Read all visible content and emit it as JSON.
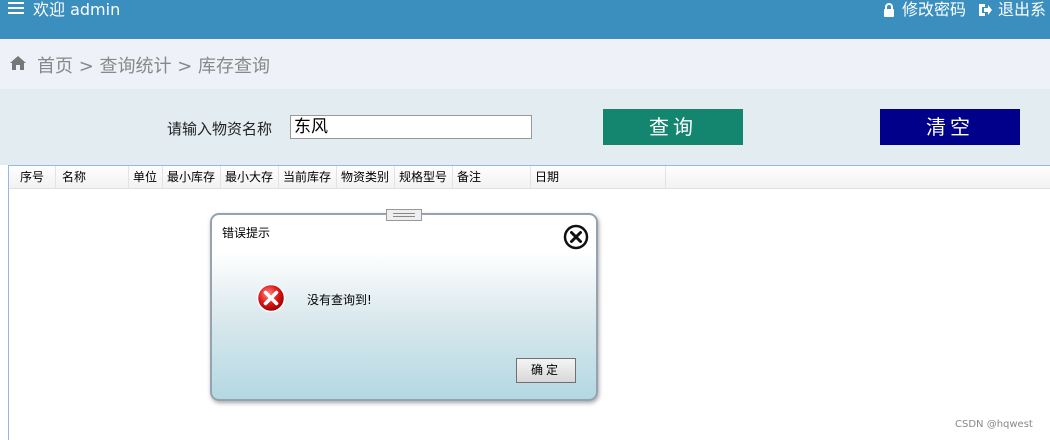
{
  "header": {
    "welcome": "欢迎 admin",
    "change_password": "修改密码",
    "logout": "退出系"
  },
  "breadcrumb": "首页 > 查询统计 > 库存查询",
  "search": {
    "label": "请输入物资名称",
    "value": "东风",
    "query_button": "查询",
    "clear_button": "清空"
  },
  "table": {
    "columns": [
      "序号",
      "名称",
      "单位",
      "最小库存",
      "最小大存",
      "当前库存",
      "物资类别",
      "规格型号",
      "备注",
      "日期"
    ]
  },
  "dialog": {
    "title": "错误提示",
    "message": "没有查询到!",
    "ok_button": "确定"
  },
  "watermark": "CSDN @hqwest",
  "colors": {
    "topbar": "#3a8fbf",
    "query_button": "#148670",
    "clear_button": "#00008b"
  }
}
